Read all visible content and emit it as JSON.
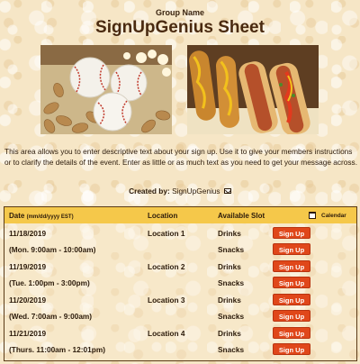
{
  "header": {
    "group_name": "Group Name",
    "title": "SignUpGenius Sheet"
  },
  "images": {
    "left": "baseball-snacks-photo",
    "right": "hotdogs-corndogs-photo"
  },
  "description": "This area allows you to enter descriptive text about your sign up. Use it to give your members instructions or to clarify the details of the event. Enter as little or as much text as you need to get your message across.",
  "created_by": {
    "label": "Created by:",
    "name": "SignUpGenius"
  },
  "table": {
    "headers": {
      "date": "Date",
      "date_format": "(mm/dd/yyyy EST)",
      "location": "Location",
      "slot": "Available Slot",
      "calendar": "Calendar"
    },
    "rows": [
      {
        "date": "11/18/2019",
        "time": "(Mon. 9:00am - 10:00am)",
        "location": "Location 1",
        "slots": [
          "Drinks",
          "Snacks"
        ]
      },
      {
        "date": "11/19/2019",
        "time": "(Tue. 1:00pm - 3:00pm)",
        "location": "Location 2",
        "slots": [
          "Drinks",
          "Snacks"
        ]
      },
      {
        "date": "11/20/2019",
        "time": "(Wed. 7:00am - 9:00am)",
        "location": "Location 3",
        "slots": [
          "Drinks",
          "Snacks"
        ]
      },
      {
        "date": "11/21/2019",
        "time": "(Thurs. 11:00am - 12:01pm)",
        "location": "Location 4",
        "slots": [
          "Drinks",
          "Snacks"
        ]
      }
    ],
    "signup_label": "Sign Up"
  },
  "colors": {
    "header_bg": "#f5c84a",
    "button": "#e0471a",
    "title": "#4a2a10"
  }
}
